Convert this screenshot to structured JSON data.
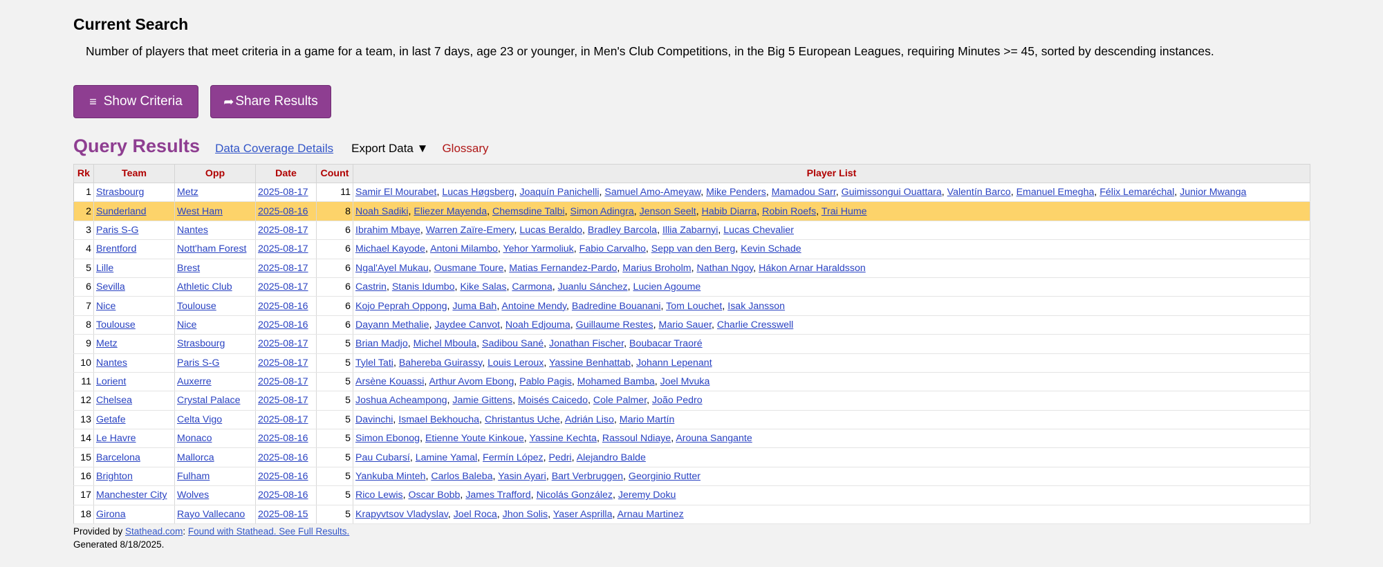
{
  "header": {
    "title": "Current Search",
    "description": "Number of players that meet criteria in a game for a team, in last 7 days, age 23 or younger, in Men's Club Competitions, in the Big 5 European Leagues, requiring Minutes >= 45, sorted by descending instances."
  },
  "buttons": {
    "show_criteria": "Show Criteria",
    "share_results": "Share Results",
    "menu_icon": "≡",
    "share_icon": "➦"
  },
  "results": {
    "title": "Query Results",
    "coverage_link": "Data Coverage Details",
    "export": "Export Data ▼",
    "glossary": "Glossary",
    "columns": [
      "Rk",
      "Team",
      "Opp",
      "Date",
      "Count",
      "Player List"
    ],
    "rows": [
      {
        "rk": "1",
        "team": "Strasbourg",
        "opp": "Metz",
        "date": "2025-08-17",
        "count": "11",
        "players": [
          "Samir El Mourabet",
          "Lucas Høgsberg",
          "Joaquín Panichelli",
          "Samuel Amo-Ameyaw",
          "Mike Penders",
          "Mamadou Sarr",
          "Guimissongui Ouattara",
          "Valentín Barco",
          "Emanuel Emegha",
          "Félix Lemaréchal",
          "Junior Mwanga"
        ]
      },
      {
        "rk": "2",
        "team": "Sunderland",
        "opp": "West Ham",
        "date": "2025-08-16",
        "count": "8",
        "players": [
          "Noah Sadiki",
          "Eliezer Mayenda",
          "Chemsdine Talbi",
          "Simon Adingra",
          "Jenson Seelt",
          "Habib Diarra",
          "Robin Roefs",
          "Trai Hume"
        ],
        "highlight": true
      },
      {
        "rk": "3",
        "team": "Paris S-G",
        "opp": "Nantes",
        "date": "2025-08-17",
        "count": "6",
        "players": [
          "Ibrahim Mbaye",
          "Warren Zaïre-Emery",
          "Lucas Beraldo",
          "Bradley Barcola",
          "Illia Zabarnyi",
          "Lucas Chevalier"
        ]
      },
      {
        "rk": "4",
        "team": "Brentford",
        "opp": "Nott'ham Forest",
        "date": "2025-08-17",
        "count": "6",
        "players": [
          "Michael Kayode",
          "Antoni Milambo",
          "Yehor Yarmoliuk",
          "Fabio Carvalho",
          "Sepp van den Berg",
          "Kevin Schade"
        ]
      },
      {
        "rk": "5",
        "team": "Lille",
        "opp": "Brest",
        "date": "2025-08-17",
        "count": "6",
        "players": [
          "Ngal'Ayel Mukau",
          "Ousmane Toure",
          "Matias Fernandez-Pardo",
          "Marius Broholm",
          "Nathan Ngoy",
          "Hákon Arnar Haraldsson"
        ]
      },
      {
        "rk": "6",
        "team": "Sevilla",
        "opp": "Athletic Club",
        "date": "2025-08-17",
        "count": "6",
        "players": [
          "Castrin",
          "Stanis Idumbo",
          "Kike Salas",
          "Carmona",
          "Juanlu Sánchez",
          "Lucien Agoume"
        ]
      },
      {
        "rk": "7",
        "team": "Nice",
        "opp": "Toulouse",
        "date": "2025-08-16",
        "count": "6",
        "players": [
          "Kojo Peprah Oppong",
          "Juma Bah",
          "Antoine Mendy",
          "Badredine Bouanani",
          "Tom Louchet",
          "Isak Jansson"
        ]
      },
      {
        "rk": "8",
        "team": "Toulouse",
        "opp": "Nice",
        "date": "2025-08-16",
        "count": "6",
        "players": [
          "Dayann Methalie",
          "Jaydee Canvot",
          "Noah Edjouma",
          "Guillaume Restes",
          "Mario Sauer",
          "Charlie Cresswell"
        ]
      },
      {
        "rk": "9",
        "team": "Metz",
        "opp": "Strasbourg",
        "date": "2025-08-17",
        "count": "5",
        "players": [
          "Brian Madjo",
          "Michel Mboula",
          "Sadibou Sané",
          "Jonathan Fischer",
          "Boubacar Traoré"
        ]
      },
      {
        "rk": "10",
        "team": "Nantes",
        "opp": "Paris S-G",
        "date": "2025-08-17",
        "count": "5",
        "players": [
          "Tylel Tati",
          "Bahereba Guirassy",
          "Louis Leroux",
          "Yassine Benhattab",
          "Johann Lepenant"
        ]
      },
      {
        "rk": "11",
        "team": "Lorient",
        "opp": "Auxerre",
        "date": "2025-08-17",
        "count": "5",
        "players": [
          "Arsène Kouassi",
          "Arthur Avom Ebong",
          "Pablo Pagis",
          "Mohamed Bamba",
          "Joel Mvuka"
        ]
      },
      {
        "rk": "12",
        "team": "Chelsea",
        "opp": "Crystal Palace",
        "date": "2025-08-17",
        "count": "5",
        "players": [
          "Joshua Acheampong",
          "Jamie Gittens",
          "Moisés Caicedo",
          "Cole Palmer",
          "João Pedro"
        ]
      },
      {
        "rk": "13",
        "team": "Getafe",
        "opp": "Celta Vigo",
        "date": "2025-08-17",
        "count": "5",
        "players": [
          "Davinchi",
          "Ismael Bekhoucha",
          "Christantus Uche",
          "Adrián Liso",
          "Mario Martín"
        ]
      },
      {
        "rk": "14",
        "team": "Le Havre",
        "opp": "Monaco",
        "date": "2025-08-16",
        "count": "5",
        "players": [
          "Simon Ebonog",
          "Etienne Youte Kinkoue",
          "Yassine Kechta",
          "Rassoul Ndiaye",
          "Arouna Sangante"
        ]
      },
      {
        "rk": "15",
        "team": "Barcelona",
        "opp": "Mallorca",
        "date": "2025-08-16",
        "count": "5",
        "players": [
          "Pau Cubarsí",
          "Lamine Yamal",
          "Fermín López",
          "Pedri",
          "Alejandro Balde"
        ]
      },
      {
        "rk": "16",
        "team": "Brighton",
        "opp": "Fulham",
        "date": "2025-08-16",
        "count": "5",
        "players": [
          "Yankuba Minteh",
          "Carlos Baleba",
          "Yasin Ayari",
          "Bart Verbruggen",
          "Georginio Rutter"
        ]
      },
      {
        "rk": "17",
        "team": "Manchester City",
        "opp": "Wolves",
        "date": "2025-08-16",
        "count": "5",
        "players": [
          "Rico Lewis",
          "Oscar Bobb",
          "James Trafford",
          "Nicolás González",
          "Jeremy Doku"
        ]
      },
      {
        "rk": "18",
        "team": "Girona",
        "opp": "Rayo Vallecano",
        "date": "2025-08-15",
        "count": "5",
        "players": [
          "Krapyvtsov Vladyslav",
          "Joel Roca",
          "Jhon Solis",
          "Yaser Asprilla",
          "Arnau Martinez"
        ]
      }
    ]
  },
  "footer": {
    "provided_by": "Provided by ",
    "site": "Stathead.com",
    "sep": ": ",
    "found_link": "Found with Stathead. See Full Results.",
    "generated": "Generated 8/18/2025."
  },
  "colors": {
    "accent": "#8e3e91",
    "link": "#2a43c2",
    "header_text": "#b00000",
    "highlight_row": "#fdd36a"
  }
}
